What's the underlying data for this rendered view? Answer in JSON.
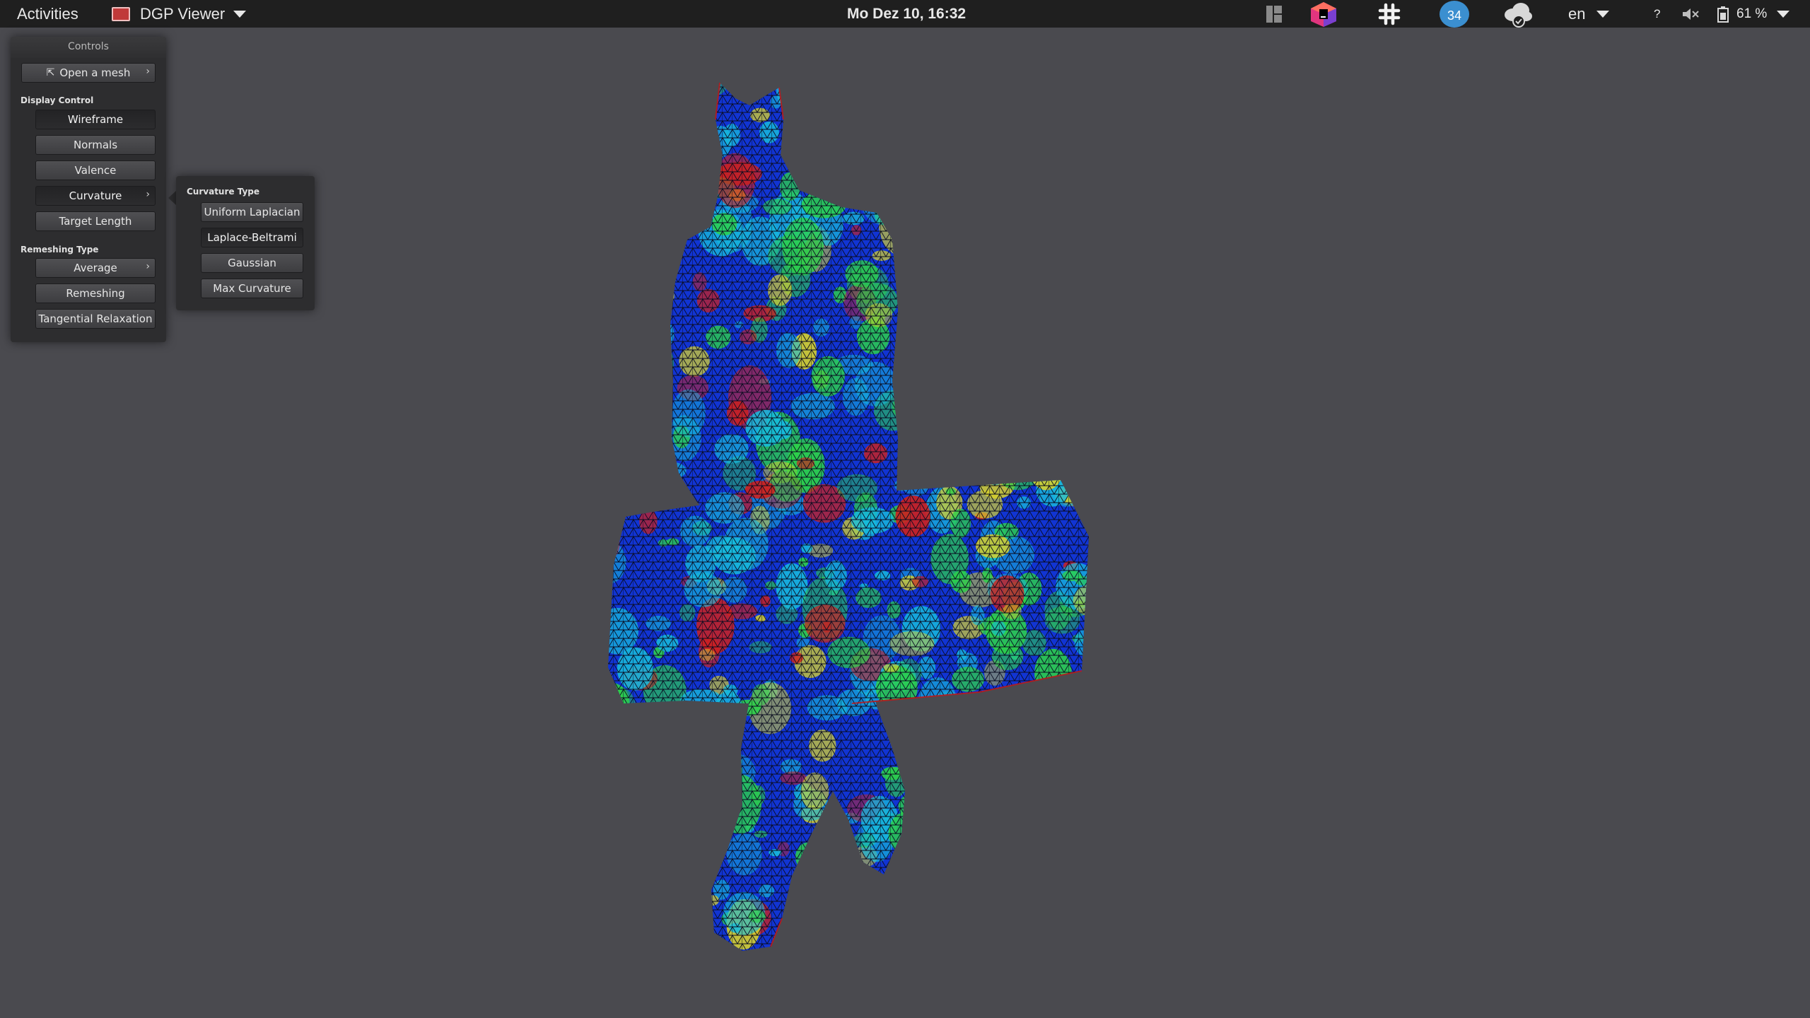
{
  "topbar": {
    "activities": "Activities",
    "app_name": "DGP Viewer",
    "clock": "Mo Dez 10, 16:32",
    "notification_count": "34",
    "language": "en",
    "help": "?",
    "battery": "61 %",
    "tray_icons": [
      "window-grid-icon",
      "app-cube-icon",
      "slack-icon",
      "notification-badge-icon",
      "cloud-sync-icon",
      "speaker-muted-icon",
      "battery-icon"
    ]
  },
  "controls": {
    "title": "Controls",
    "open_mesh": "Open a mesh",
    "display_control_label": "Display Control",
    "wireframe": "Wireframe",
    "normals": "Normals",
    "valence": "Valence",
    "curvature": "Curvature",
    "target_length": "Target Length",
    "remeshing_type_label": "Remeshing Type",
    "average": "Average",
    "remeshing": "Remeshing",
    "tangential_relaxation": "Tangential Relaxation"
  },
  "curvature_menu": {
    "title": "Curvature Type",
    "uniform_laplacian": "Uniform Laplacian",
    "laplace_beltrami": "Laplace-Beltrami",
    "gaussian": "Gaussian",
    "max_curvature": "Max Curvature",
    "selected": "Laplace-Beltrami"
  },
  "viewport": {
    "background": "#4a4a4f",
    "mesh_colormap": [
      "#1030d0",
      "#18c8e0",
      "#30e040",
      "#e8e020",
      "#e02010"
    ],
    "mesh_description": "curvature-colored triangle wireframe mesh"
  }
}
